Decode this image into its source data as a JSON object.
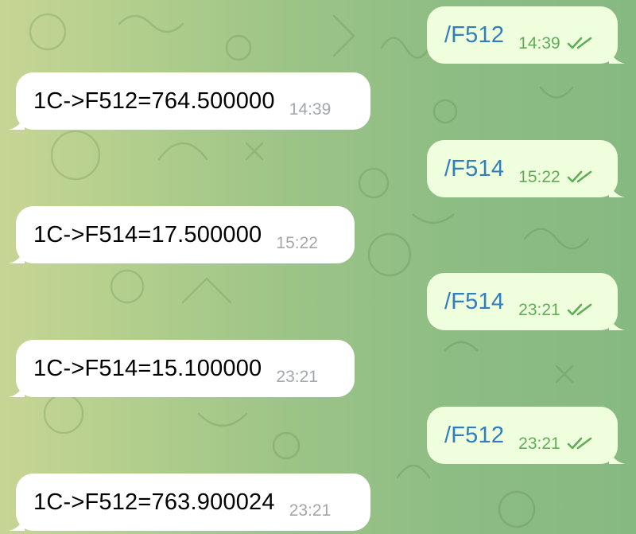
{
  "chat": {
    "messages": [
      {
        "direction": "outgoing",
        "text": "/F512",
        "time": "14:39",
        "status_icon": "double-check-icon"
      },
      {
        "direction": "incoming",
        "text": "1C->F512=764.500000",
        "time": "14:39"
      },
      {
        "direction": "outgoing",
        "text": "/F514",
        "time": "15:22",
        "status_icon": "double-check-icon"
      },
      {
        "direction": "incoming",
        "text": "1C->F514=17.500000",
        "time": "15:22"
      },
      {
        "direction": "outgoing",
        "text": "/F514",
        "time": "23:21",
        "status_icon": "double-check-icon"
      },
      {
        "direction": "incoming",
        "text": "1C->F514=15.100000",
        "time": "23:21"
      },
      {
        "direction": "outgoing",
        "text": "/F512",
        "time": "23:21",
        "status_icon": "double-check-icon"
      },
      {
        "direction": "incoming",
        "text": "1C->F512=763.900024",
        "time": "23:21"
      }
    ]
  },
  "colors": {
    "incoming_bubble": "#ffffff",
    "outgoing_bubble": "#effedd",
    "command_text": "#2f7fbf",
    "outgoing_time": "#5fae57",
    "incoming_time": "#a3a7ab"
  }
}
